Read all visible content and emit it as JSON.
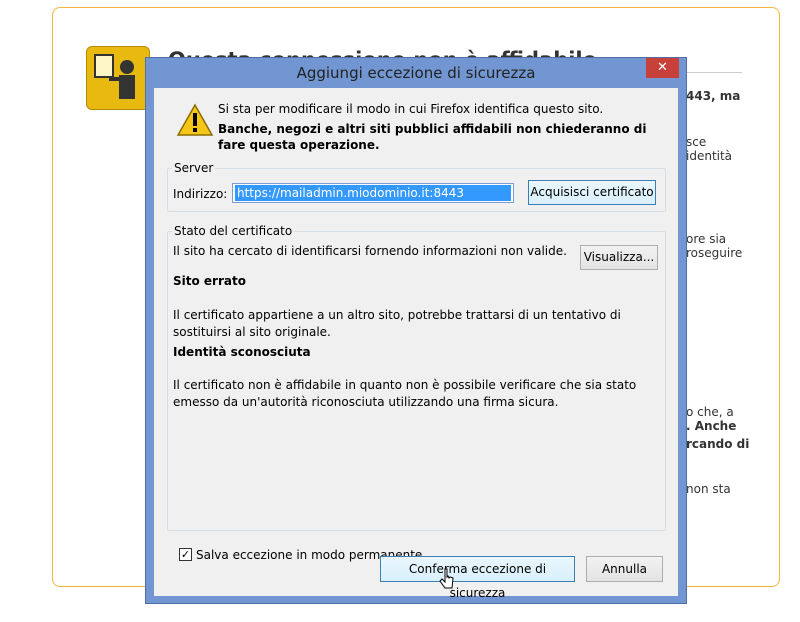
{
  "background": {
    "title": "Questa connessione non è affidabile",
    "fragments": [
      {
        "text": "443, ma",
        "bold": true
      },
      {
        "text": "sce",
        "bold": false
      },
      {
        "text": "identità",
        "bold": false
      },
      {
        "text": "ore sia",
        "bold": false
      },
      {
        "text": "roseguire",
        "bold": false
      },
      {
        "text": "o che, a",
        "bold": false
      },
      {
        "text": ". Anche",
        "bold": true
      },
      {
        "text": "rcando di",
        "bold": true
      },
      {
        "text": "non sta",
        "bold": false
      }
    ]
  },
  "dialog": {
    "title": "Aggiungi eccezione di sicurezza",
    "close_glyph": "✕",
    "intro": "Si sta per modificare il modo in cui Firefox identifica questo sito.",
    "warning": "Banche, negozi e altri siti pubblici affidabili non chiederanno di fare questa operazione.",
    "server": {
      "legend": "Server",
      "address_label": "Indirizzo:",
      "address_value": "https://mailadmin.miodominio.it:8443",
      "get_cert_button": "Acquisisci certificato"
    },
    "cert_status": {
      "legend": "Stato del certificato",
      "summary": "Il sito ha cercato di identificarsi fornendo informazioni non valide.",
      "view_button": "Visualizza...",
      "wrong_site_heading": "Sito errato",
      "wrong_site_text": "Il certificato appartiene a un altro sito, potrebbe trattarsi di un tentativo di sostituirsi al sito originale.",
      "unknown_identity_heading": "Identità sconosciuta",
      "unknown_identity_text": "Il certificato non è affidabile in quanto non è possibile verificare che sia stato emesso da un'autorità riconosciuta utilizzando una firma sicura."
    },
    "permanent_checkbox": {
      "label": "Salva eccezione in modo permanente",
      "checked_glyph": "✓"
    },
    "confirm_button": "Conferma eccezione di sicurezza",
    "cancel_button": "Annulla"
  },
  "colors": {
    "accent": "#7196d1",
    "close": "#c7403a",
    "selection": "#3399ff",
    "warning": "#f5c518"
  }
}
